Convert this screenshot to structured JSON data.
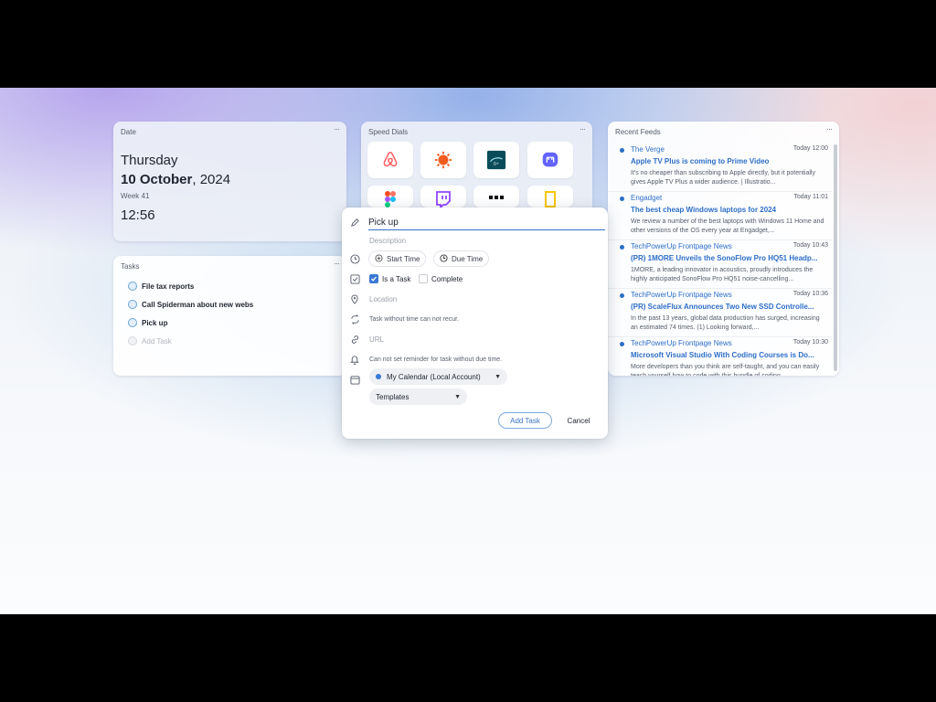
{
  "date_widget": {
    "title": "Date",
    "more": "···",
    "weekday": "Thursday",
    "day_month": "10 October",
    "year": ", 2024",
    "week": "Week 41",
    "time": "12:56"
  },
  "speed_dials": {
    "title": "Speed Dials",
    "more": "···",
    "items": [
      {
        "icon": "airbnb-icon",
        "color": "#ff5a5f"
      },
      {
        "icon": "sun-flower-icon",
        "color": "#f25c1e"
      },
      {
        "icon": "disney-plus-icon",
        "color": "#0b4c5a"
      },
      {
        "icon": "mastodon-icon",
        "color": "#6364ff"
      },
      {
        "icon": "figma-icon",
        "color": "#a259ff"
      },
      {
        "icon": "twitch-icon",
        "color": "#9146ff"
      },
      {
        "icon": "dots-app-icon",
        "color": "#111111"
      },
      {
        "icon": "national-geographic-icon",
        "color": "#f7c600"
      }
    ]
  },
  "tasks_widget": {
    "title": "Tasks",
    "more": "···",
    "items": [
      "File tax reports",
      "Call Spiderman about new webs",
      "Pick up"
    ],
    "add_placeholder": "Add Task"
  },
  "feeds_widget": {
    "title": "Recent Feeds",
    "more": "···",
    "items": [
      {
        "source": "The Verge",
        "time": "Today 12:00",
        "headline": "Apple TV Plus is coming to Prime Video",
        "summary": "It's no cheaper than subscribing to Apple directly, but it potentially gives Apple TV Plus a wider audience. | Illustratio..."
      },
      {
        "source": "Engadget",
        "time": "Today 11:01",
        "headline": "The best cheap Windows laptops for 2024",
        "summary": "We review a number of the best laptops with Windows 11 Home and other versions of the OS every year at Engadget,..."
      },
      {
        "source": "TechPowerUp Frontpage News",
        "time": "Today 10:43",
        "headline": "(PR) 1MORE Unveils the SonoFlow Pro HQ51 Headp...",
        "summary": "1MORE, a leading innovator in acoustics, proudly introduces the highly anticipated SonoFlow Pro HQ51 noise-cancelling..."
      },
      {
        "source": "TechPowerUp Frontpage News",
        "time": "Today 10:36",
        "headline": "(PR) ScaleFlux Announces Two New SSD Controlle...",
        "summary": "In the past 13 years, global data production has surged, increasing an estimated 74 times. (1) Looking forward,..."
      },
      {
        "source": "TechPowerUp Frontpage News",
        "time": "Today 10:30",
        "headline": "Microsoft Visual Studio With Coding Courses is Do...",
        "summary": "More developers than you think are self-taught, and you can easily teach yourself how to code with this bundle of coding..."
      }
    ]
  },
  "task_dialog": {
    "title_value": "Pick up",
    "description_placeholder": "Description",
    "start_time_label": "Start Time",
    "due_time_label": "Due Time",
    "is_task_label": "Is a Task",
    "is_task_checked": true,
    "complete_label": "Complete",
    "complete_checked": false,
    "location_placeholder": "Location",
    "recur_note": "Task without time can not recur.",
    "url_placeholder": "URL",
    "reminder_note": "Can not set reminder for task without due time.",
    "calendar_select": "My Calendar (Local Account)",
    "calendar_color": "#3a78d4",
    "templates_select": "Templates",
    "add_button": "Add Task",
    "cancel_button": "Cancel"
  }
}
